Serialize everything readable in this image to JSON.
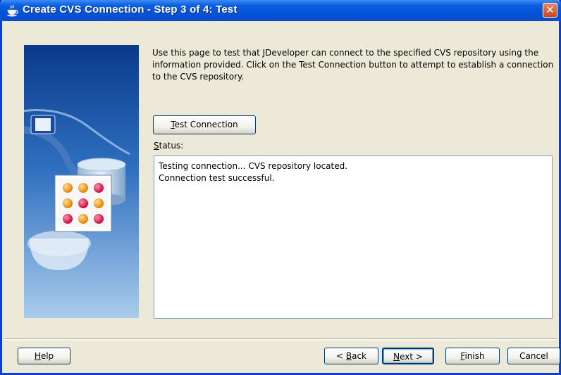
{
  "window": {
    "title": "Create CVS Connection - Step 3 of 4: Test",
    "close_glyph": "✕"
  },
  "intro_text": "Use this page to test that JDeveloper can connect to the specified CVS repository using the information provided. Click on the Test Connection button to attempt to establish a connection to the CVS repository.",
  "test_button": {
    "mnemonic": "T",
    "rest": "est Connection"
  },
  "status": {
    "label_mnemonic": "S",
    "label_rest": "tatus:",
    "lines": [
      "Testing connection... CVS repository located.",
      "Connection test successful."
    ]
  },
  "buttons": {
    "help": {
      "mnemonic": "H",
      "rest": "elp"
    },
    "back": {
      "prefix": "< ",
      "mnemonic": "B",
      "rest": "ack"
    },
    "next": {
      "mnemonic": "N",
      "rest": "ext >"
    },
    "finish": {
      "mnemonic": "F",
      "rest": "inish"
    },
    "cancel": "Cancel"
  },
  "colors": {
    "titlebar": "#0553d8",
    "dialog_bg": "#ece9d8",
    "side_panel_top": "#0a3a8a",
    "side_panel_bottom": "#a9ccec"
  },
  "icons": [
    "coffee-cup-icon",
    "close-icon",
    "wizard-banner-image"
  ]
}
